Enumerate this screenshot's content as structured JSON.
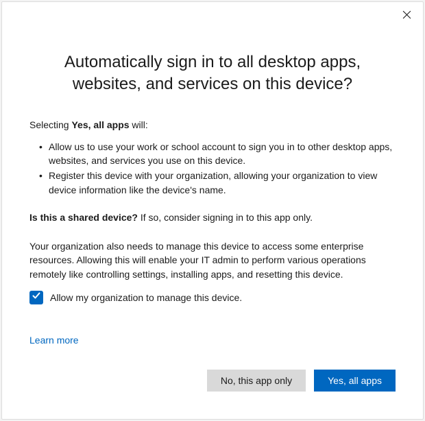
{
  "header": {
    "title": "Automatically sign in to all desktop apps, websites, and services on this device?"
  },
  "intro": {
    "prefix": "Selecting ",
    "bold": "Yes, all apps",
    "suffix": " will:"
  },
  "bullets": [
    "Allow us to use your work or school account to sign you in to other desktop apps, websites, and services you use on this device.",
    "Register this device with your organization, allowing your organization to view device information like the device's name."
  ],
  "shared": {
    "question": "Is this a shared device?",
    "note": " If so, consider signing in to this app only."
  },
  "org_text": "Your organization also needs to manage this device to access some enterprise resources. Allowing this will enable your IT admin to perform various operations remotely like controlling settings, installing apps, and resetting this device.",
  "checkbox": {
    "checked": true,
    "label": "Allow my organization to manage this device."
  },
  "learn_more": "Learn more",
  "footer": {
    "secondary": "No, this app only",
    "primary": "Yes, all apps"
  }
}
